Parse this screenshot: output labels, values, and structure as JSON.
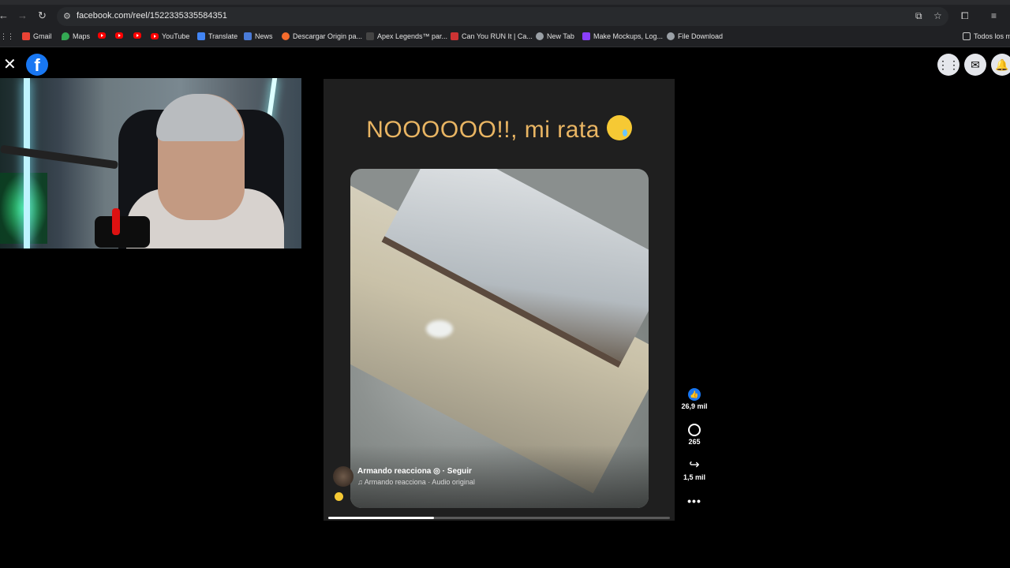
{
  "browser": {
    "url": "facebook.com/reel/1522335335584351",
    "back_icon": "back-arrow-icon",
    "forward_icon": "forward-arrow-icon",
    "reload_icon": "reload-icon",
    "bookmarks": [
      {
        "label": "Gmail",
        "icon": "gmail-icon"
      },
      {
        "label": "Maps",
        "icon": "maps-icon"
      },
      {
        "label": "",
        "icon": "youtube-icon"
      },
      {
        "label": "",
        "icon": "youtube-icon"
      },
      {
        "label": "",
        "icon": "youtube-icon"
      },
      {
        "label": "YouTube",
        "icon": "youtube-icon"
      },
      {
        "label": "Translate",
        "icon": "translate-icon"
      },
      {
        "label": "News",
        "icon": "news-icon"
      },
      {
        "label": "Descargar Origin pa...",
        "icon": "origin-icon"
      },
      {
        "label": "Apex Legends™ par...",
        "icon": "apex-icon"
      },
      {
        "label": "Can You RUN It | Ca...",
        "icon": "canyourunit-icon"
      },
      {
        "label": "New Tab",
        "icon": "globe-icon"
      },
      {
        "label": "Make Mockups, Log...",
        "icon": "placeit-icon"
      },
      {
        "label": "File Download",
        "icon": "globe-icon"
      }
    ],
    "all_bookmarks_label": "Todos los m"
  },
  "reel": {
    "caption": "NOOOOOO!!, mi rata",
    "author": "Armando reacciona",
    "follow_label": "Seguir",
    "audio": "Armando reacciona · Audio original",
    "likes": "26,9 mil",
    "comments": "265",
    "shares": "1,5 mil",
    "more_label": "•••",
    "progress": 0.31
  },
  "colors": {
    "caption": "#e9b563",
    "brand": "#1877f2"
  }
}
